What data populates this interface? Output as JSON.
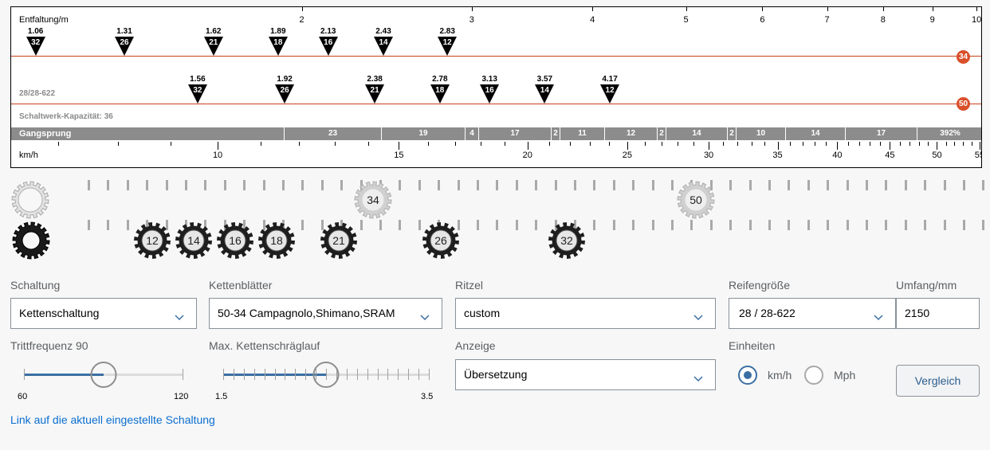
{
  "chart": {
    "top_axis_label": "Entfaltung/m",
    "top_ticks": [
      "2",
      "3",
      "4",
      "5",
      "6",
      "7",
      "8",
      "9",
      "10"
    ],
    "rows": [
      {
        "chainring": "34",
        "markers": [
          {
            "ratio": "1.06",
            "cog": "32"
          },
          {
            "ratio": "1.31",
            "cog": "26"
          },
          {
            "ratio": "1.62",
            "cog": "21"
          },
          {
            "ratio": "1.89",
            "cog": "18"
          },
          {
            "ratio": "2.13",
            "cog": "16"
          },
          {
            "ratio": "2.43",
            "cog": "14"
          },
          {
            "ratio": "2.83",
            "cog": "12"
          }
        ]
      },
      {
        "chainring": "50",
        "markers": [
          {
            "ratio": "1.56",
            "cog": "32"
          },
          {
            "ratio": "1.92",
            "cog": "26"
          },
          {
            "ratio": "2.38",
            "cog": "21"
          },
          {
            "ratio": "2.78",
            "cog": "18"
          },
          {
            "ratio": "3.13",
            "cog": "16"
          },
          {
            "ratio": "3.57",
            "cog": "14"
          },
          {
            "ratio": "4.17",
            "cog": "12"
          }
        ]
      }
    ],
    "tire_note": "28/28-622",
    "capacity_note": "Schaltwerk-Kapazität: 36",
    "jump_label": "Gangsprung",
    "jumps": [
      "23",
      "19",
      "4",
      "17",
      "2",
      "11",
      "12",
      "2",
      "14",
      "2",
      "10",
      "14",
      "17",
      "392%"
    ],
    "bottom_axis_label": "km/h",
    "bottom_ticks": [
      "10",
      "15",
      "20",
      "25",
      "30",
      "35",
      "40",
      "45",
      "50",
      "55"
    ]
  },
  "gears": {
    "chainrings": [
      "34",
      "50"
    ],
    "cogs": [
      "12",
      "14",
      "16",
      "18",
      "21",
      "26",
      "32"
    ]
  },
  "form": {
    "schaltung": {
      "label": "Schaltung",
      "value": "Kettenschaltung"
    },
    "kettenblaetter": {
      "label": "Kettenblätter",
      "value": "50-34 Campagnolo,Shimano,SRAM"
    },
    "ritzel": {
      "label": "Ritzel",
      "value": "custom"
    },
    "reifen": {
      "label": "Reifengröße",
      "value": "28 / 28-622"
    },
    "umfang": {
      "label": "Umfang/mm",
      "value": "2150"
    },
    "trittfrequenz": {
      "label": "Trittfrequenz 90",
      "min": "60",
      "max": "120",
      "value": 90
    },
    "kettenschraeglauf": {
      "label": "Max. Kettenschräglauf",
      "min": "1.5",
      "max": "3.5",
      "value": 2.5
    },
    "anzeige": {
      "label": "Anzeige",
      "value": "Übersetzung"
    },
    "einheiten": {
      "label": "Einheiten",
      "options": [
        "km/h",
        "Mph"
      ],
      "selected": "km/h"
    },
    "vergleich_button": "Vergleich",
    "link_text": "Link auf die aktuell eingestellte Schaltung"
  },
  "colors": {
    "accent": "#3a6fa3",
    "chainring_badge": "#d9502a",
    "link": "#0a6ed1"
  }
}
